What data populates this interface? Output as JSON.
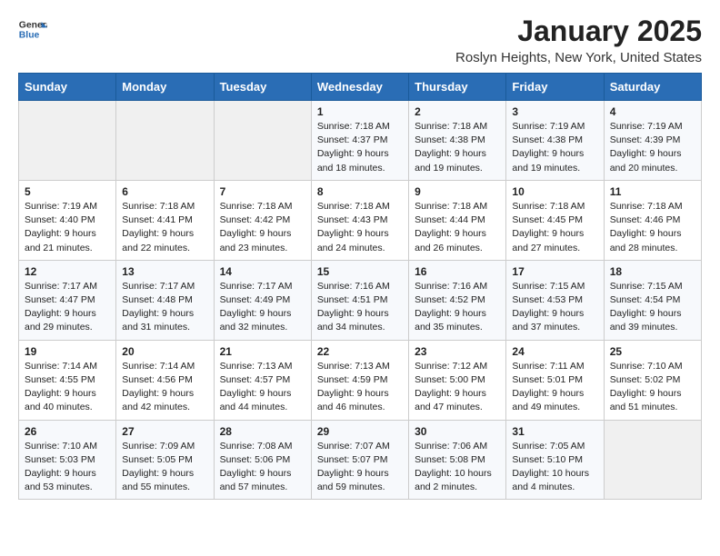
{
  "header": {
    "logo_general": "General",
    "logo_blue": "Blue",
    "month": "January 2025",
    "location": "Roslyn Heights, New York, United States"
  },
  "days_of_week": [
    "Sunday",
    "Monday",
    "Tuesday",
    "Wednesday",
    "Thursday",
    "Friday",
    "Saturday"
  ],
  "weeks": [
    [
      {
        "day": "",
        "sunrise": "",
        "sunset": "",
        "daylight": "",
        "empty": true
      },
      {
        "day": "",
        "sunrise": "",
        "sunset": "",
        "daylight": "",
        "empty": true
      },
      {
        "day": "",
        "sunrise": "",
        "sunset": "",
        "daylight": "",
        "empty": true
      },
      {
        "day": "1",
        "sunrise": "Sunrise: 7:18 AM",
        "sunset": "Sunset: 4:37 PM",
        "daylight": "Daylight: 9 hours and 18 minutes."
      },
      {
        "day": "2",
        "sunrise": "Sunrise: 7:18 AM",
        "sunset": "Sunset: 4:38 PM",
        "daylight": "Daylight: 9 hours and 19 minutes."
      },
      {
        "day": "3",
        "sunrise": "Sunrise: 7:19 AM",
        "sunset": "Sunset: 4:38 PM",
        "daylight": "Daylight: 9 hours and 19 minutes."
      },
      {
        "day": "4",
        "sunrise": "Sunrise: 7:19 AM",
        "sunset": "Sunset: 4:39 PM",
        "daylight": "Daylight: 9 hours and 20 minutes."
      }
    ],
    [
      {
        "day": "5",
        "sunrise": "Sunrise: 7:19 AM",
        "sunset": "Sunset: 4:40 PM",
        "daylight": "Daylight: 9 hours and 21 minutes."
      },
      {
        "day": "6",
        "sunrise": "Sunrise: 7:18 AM",
        "sunset": "Sunset: 4:41 PM",
        "daylight": "Daylight: 9 hours and 22 minutes."
      },
      {
        "day": "7",
        "sunrise": "Sunrise: 7:18 AM",
        "sunset": "Sunset: 4:42 PM",
        "daylight": "Daylight: 9 hours and 23 minutes."
      },
      {
        "day": "8",
        "sunrise": "Sunrise: 7:18 AM",
        "sunset": "Sunset: 4:43 PM",
        "daylight": "Daylight: 9 hours and 24 minutes."
      },
      {
        "day": "9",
        "sunrise": "Sunrise: 7:18 AM",
        "sunset": "Sunset: 4:44 PM",
        "daylight": "Daylight: 9 hours and 26 minutes."
      },
      {
        "day": "10",
        "sunrise": "Sunrise: 7:18 AM",
        "sunset": "Sunset: 4:45 PM",
        "daylight": "Daylight: 9 hours and 27 minutes."
      },
      {
        "day": "11",
        "sunrise": "Sunrise: 7:18 AM",
        "sunset": "Sunset: 4:46 PM",
        "daylight": "Daylight: 9 hours and 28 minutes."
      }
    ],
    [
      {
        "day": "12",
        "sunrise": "Sunrise: 7:17 AM",
        "sunset": "Sunset: 4:47 PM",
        "daylight": "Daylight: 9 hours and 29 minutes."
      },
      {
        "day": "13",
        "sunrise": "Sunrise: 7:17 AM",
        "sunset": "Sunset: 4:48 PM",
        "daylight": "Daylight: 9 hours and 31 minutes."
      },
      {
        "day": "14",
        "sunrise": "Sunrise: 7:17 AM",
        "sunset": "Sunset: 4:49 PM",
        "daylight": "Daylight: 9 hours and 32 minutes."
      },
      {
        "day": "15",
        "sunrise": "Sunrise: 7:16 AM",
        "sunset": "Sunset: 4:51 PM",
        "daylight": "Daylight: 9 hours and 34 minutes."
      },
      {
        "day": "16",
        "sunrise": "Sunrise: 7:16 AM",
        "sunset": "Sunset: 4:52 PM",
        "daylight": "Daylight: 9 hours and 35 minutes."
      },
      {
        "day": "17",
        "sunrise": "Sunrise: 7:15 AM",
        "sunset": "Sunset: 4:53 PM",
        "daylight": "Daylight: 9 hours and 37 minutes."
      },
      {
        "day": "18",
        "sunrise": "Sunrise: 7:15 AM",
        "sunset": "Sunset: 4:54 PM",
        "daylight": "Daylight: 9 hours and 39 minutes."
      }
    ],
    [
      {
        "day": "19",
        "sunrise": "Sunrise: 7:14 AM",
        "sunset": "Sunset: 4:55 PM",
        "daylight": "Daylight: 9 hours and 40 minutes."
      },
      {
        "day": "20",
        "sunrise": "Sunrise: 7:14 AM",
        "sunset": "Sunset: 4:56 PM",
        "daylight": "Daylight: 9 hours and 42 minutes."
      },
      {
        "day": "21",
        "sunrise": "Sunrise: 7:13 AM",
        "sunset": "Sunset: 4:57 PM",
        "daylight": "Daylight: 9 hours and 44 minutes."
      },
      {
        "day": "22",
        "sunrise": "Sunrise: 7:13 AM",
        "sunset": "Sunset: 4:59 PM",
        "daylight": "Daylight: 9 hours and 46 minutes."
      },
      {
        "day": "23",
        "sunrise": "Sunrise: 7:12 AM",
        "sunset": "Sunset: 5:00 PM",
        "daylight": "Daylight: 9 hours and 47 minutes."
      },
      {
        "day": "24",
        "sunrise": "Sunrise: 7:11 AM",
        "sunset": "Sunset: 5:01 PM",
        "daylight": "Daylight: 9 hours and 49 minutes."
      },
      {
        "day": "25",
        "sunrise": "Sunrise: 7:10 AM",
        "sunset": "Sunset: 5:02 PM",
        "daylight": "Daylight: 9 hours and 51 minutes."
      }
    ],
    [
      {
        "day": "26",
        "sunrise": "Sunrise: 7:10 AM",
        "sunset": "Sunset: 5:03 PM",
        "daylight": "Daylight: 9 hours and 53 minutes."
      },
      {
        "day": "27",
        "sunrise": "Sunrise: 7:09 AM",
        "sunset": "Sunset: 5:05 PM",
        "daylight": "Daylight: 9 hours and 55 minutes."
      },
      {
        "day": "28",
        "sunrise": "Sunrise: 7:08 AM",
        "sunset": "Sunset: 5:06 PM",
        "daylight": "Daylight: 9 hours and 57 minutes."
      },
      {
        "day": "29",
        "sunrise": "Sunrise: 7:07 AM",
        "sunset": "Sunset: 5:07 PM",
        "daylight": "Daylight: 9 hours and 59 minutes."
      },
      {
        "day": "30",
        "sunrise": "Sunrise: 7:06 AM",
        "sunset": "Sunset: 5:08 PM",
        "daylight": "Daylight: 10 hours and 2 minutes."
      },
      {
        "day": "31",
        "sunrise": "Sunrise: 7:05 AM",
        "sunset": "Sunset: 5:10 PM",
        "daylight": "Daylight: 10 hours and 4 minutes."
      },
      {
        "day": "",
        "sunrise": "",
        "sunset": "",
        "daylight": "",
        "empty": true
      }
    ]
  ]
}
